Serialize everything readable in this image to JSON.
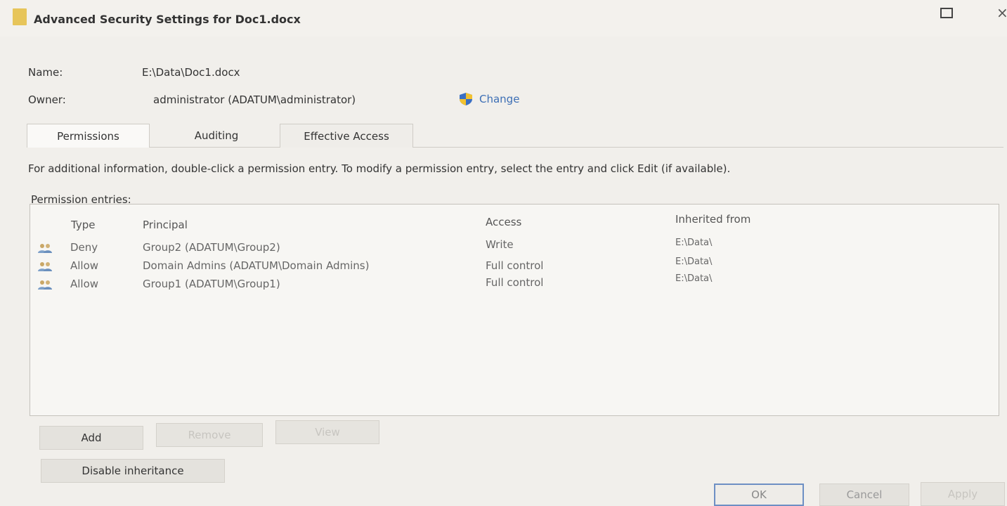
{
  "window": {
    "title": "Advanced Security Settings for Doc1.docx",
    "maximize_glyph": "",
    "close_glyph": "×"
  },
  "fields": {
    "name_label": "Name:",
    "name_value": "E:\\Data\\Doc1.docx",
    "owner_label": "Owner:",
    "owner_value": "administrator (ADATUM\\administrator)",
    "change_link": "Change"
  },
  "tabs": [
    {
      "label": "Permissions",
      "active": true
    },
    {
      "label": "Auditing",
      "active": false
    },
    {
      "label": "Effective Access",
      "active": false
    }
  ],
  "info_text": "For additional information, double-click a permission entry. To modify a permission entry, select the entry and click Edit (if available).",
  "entries_label": "Permission entries:",
  "columns": {
    "type": "Type",
    "principal": "Principal",
    "access": "Access",
    "inherited": "Inherited from"
  },
  "rows": [
    {
      "type": "Deny",
      "principal": "Group2 (ADATUM\\Group2)",
      "access": "Write",
      "inherited": "E:\\Data\\"
    },
    {
      "type": "Allow",
      "principal": "Domain Admins (ADATUM\\Domain Admins)",
      "access": "Full control",
      "inherited": "E:\\Data\\"
    },
    {
      "type": "Allow",
      "principal": "Group1 (ADATUM\\Group1)",
      "access": "Full control",
      "inherited": "E:\\Data\\"
    }
  ],
  "buttons": {
    "add": "Add",
    "remove": "Remove",
    "view": "View",
    "disable_inheritance": "Disable inheritance",
    "ok": "OK",
    "cancel": "Cancel",
    "apply": "Apply"
  },
  "colors": {
    "link": "#3d6fb5",
    "shield_blue": "#3a6fc4",
    "shield_yellow": "#f2c230"
  },
  "icons": [
    "folder-icon",
    "shield-icon",
    "user-group-icon"
  ]
}
